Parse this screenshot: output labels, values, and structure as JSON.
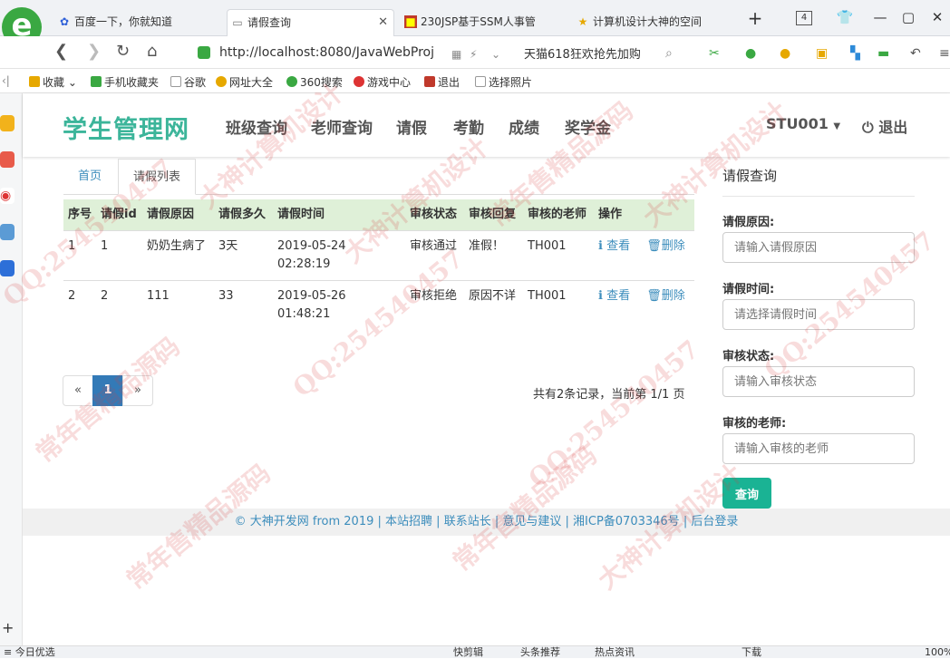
{
  "browser": {
    "tabs": [
      {
        "icon": "paw-icon",
        "label": "百度一下，你就知道"
      },
      {
        "icon": "page-icon",
        "label": "请假查询"
      },
      {
        "icon": "red-square-icon",
        "label": "230JSP基于SSM人事管"
      },
      {
        "icon": "star-icon",
        "label": "计算机设计大神的空间"
      }
    ],
    "tab_count": "4",
    "url": "http://localhost:8080/JavaWebProj",
    "search_hint": "天猫618狂欢抢先加购",
    "bookmarks": [
      "收藏",
      "手机收藏夹",
      "谷歌",
      "网址大全",
      "360搜索",
      "游戏中心",
      "退出",
      "选择照片"
    ]
  },
  "nav": {
    "brand": "学生管理网",
    "links": [
      "班级查询",
      "老师查询",
      "请假",
      "考勤",
      "成绩",
      "奖学金"
    ],
    "user": "STU001",
    "logout": "退出"
  },
  "page_tabs": [
    "首页",
    "请假列表"
  ],
  "table": {
    "headers": [
      "序号",
      "请假id",
      "请假原因",
      "请假多久",
      "请假时间",
      "审核状态",
      "审核回复",
      "审核的老师",
      "操作"
    ],
    "rows": [
      {
        "no": "1",
        "id": "1",
        "reason": "奶奶生病了",
        "duration": "3天",
        "time": "2019-05-24 02:28:19",
        "status": "审核通过",
        "reply": "准假！",
        "teacher": "TH001"
      },
      {
        "no": "2",
        "id": "2",
        "reason": "111",
        "duration": "33",
        "time": "2019-05-26 01:48:21",
        "status": "审核拒绝",
        "reply": "原因不详",
        "teacher": "TH001"
      }
    ],
    "view_label": "查看",
    "delete_label": "删除"
  },
  "pagination": {
    "prev": "«",
    "current": "1",
    "next": "»",
    "info": "共有2条记录，当前第 1/1 页"
  },
  "search_panel": {
    "title": "请假查询",
    "fields": [
      {
        "label": "请假原因:",
        "placeholder": "请输入请假原因"
      },
      {
        "label": "请假时间:",
        "placeholder": "请选择请假时间"
      },
      {
        "label": "审核状态:",
        "placeholder": "请输入审核状态"
      },
      {
        "label": "审核的老师:",
        "placeholder": "请输入审核的老师"
      }
    ],
    "submit": "查询"
  },
  "footer": {
    "links": [
      "© 大神开发网 from 2019",
      "本站招聘",
      "联系站长",
      "意见与建议",
      "湘ICP备0703346号",
      "后台登录"
    ]
  },
  "statusbar": {
    "left": "今日优选",
    "items": [
      "快剪辑",
      "头条推荐",
      "热点资讯",
      "下载"
    ],
    "zoom": "100%"
  },
  "watermarks": [
    "QQ:254540457",
    "大神计算机设计",
    "常年售精品源码",
    "QQ:254540457",
    "大神计算机设计",
    "常年售精品源码",
    "QQ:254540457",
    "大神计算机设计",
    "常年售精品源码",
    "QQ:254540457",
    "大神计算机设计",
    "常年售精品源码"
  ]
}
